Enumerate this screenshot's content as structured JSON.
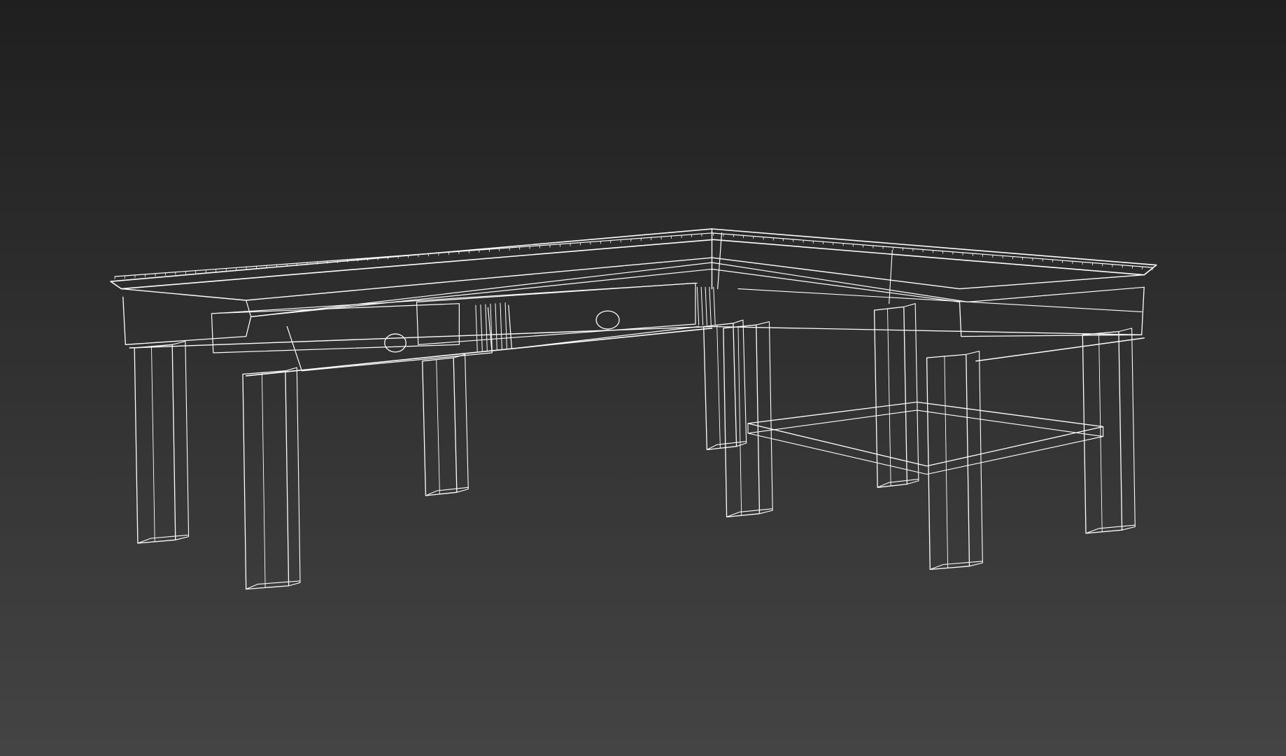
{
  "viewport": {
    "view_mode": "wireframe",
    "background_top_color": "#1f1f1f",
    "background_bottom_color": "#444444",
    "wire_color": "#ffffff"
  },
  "model": {
    "object": "l-shaped-corner-desk",
    "legs": 8,
    "drawers": 2,
    "shelves": 1
  }
}
